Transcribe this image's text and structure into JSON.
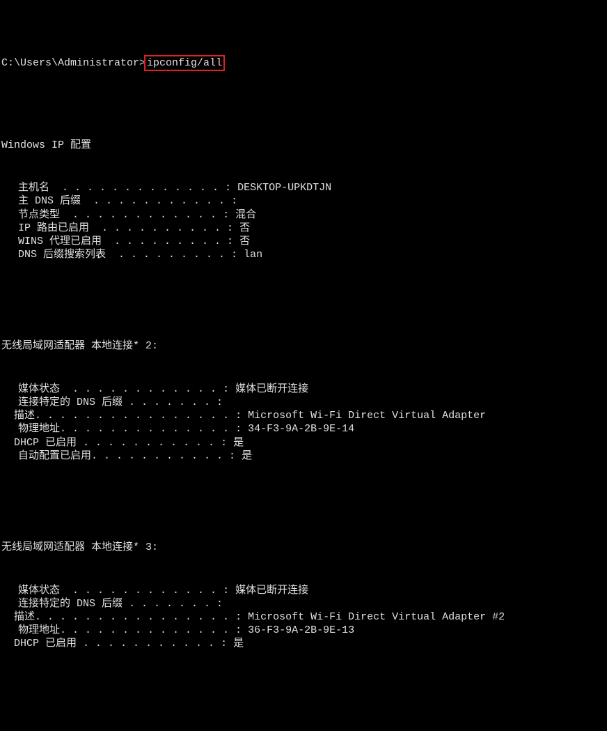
{
  "prompt": {
    "path": "C:\\Users\\Administrator>",
    "command": "ipconfig/all"
  },
  "header": "Windows IP 配置",
  "windows_ip": [
    {
      "label": "主机名 ",
      "dots": " . . . . . . . . . . . . . ",
      "value": "DESKTOP-UPKDTJN"
    },
    {
      "label": "主 DNS 后缀 ",
      "dots": " . . . . . . . . . . . ",
      "value": ""
    },
    {
      "label": "节点类型 ",
      "dots": " . . . . . . . . . . . . ",
      "value": "混合"
    },
    {
      "label": "IP 路由已启用 ",
      "dots": " . . . . . . . . . . ",
      "value": "否"
    },
    {
      "label": "WINS 代理已启用 ",
      "dots": " . . . . . . . . . ",
      "value": "否"
    },
    {
      "label": "DNS 后缀搜索列表 ",
      "dots": " . . . . . . . . . ",
      "value": "lan"
    }
  ],
  "adapter2": {
    "title": "无线局域网适配器 本地连接* 2:",
    "rows": [
      {
        "indent": "indent",
        "label": "媒体状态 ",
        "dots": " . . . . . . . . . . . . ",
        "value": "媒体已断开连接"
      },
      {
        "indent": "indent",
        "label": "连接特定的 DNS 后缀 ",
        "dots": ". . . . . . . ",
        "value": ""
      },
      {
        "indent": "small-indent",
        "label": "描述.",
        "dots": " . . . . . . . . . . . . . . . ",
        "value": "Microsoft Wi-Fi Direct Virtual Adapter"
      },
      {
        "indent": "indent",
        "label": "物理地址.",
        "dots": " . . . . . . . . . . . . . ",
        "value": "34-F3-9A-2B-9E-14"
      },
      {
        "indent": "small-indent",
        "label": "DHCP 已启用 ",
        "dots": ". . . . . . . . . . . ",
        "value": "是"
      },
      {
        "indent": "indent",
        "label": "自动配置已启用.",
        "dots": " . . . . . . . . . . ",
        "value": "是"
      }
    ]
  },
  "adapter3": {
    "title": "无线局域网适配器 本地连接* 3:",
    "rows": [
      {
        "indent": "indent",
        "label": "媒体状态 ",
        "dots": " . . . . . . . . . . . . ",
        "value": "媒体已断开连接"
      },
      {
        "indent": "indent",
        "label": "连接特定的 DNS 后缀 ",
        "dots": ". . . . . . . ",
        "value": ""
      },
      {
        "indent": "small-indent",
        "label": "描述.",
        "dots": " . . . . . . . . . . . . . . . ",
        "value": "Microsoft Wi-Fi Direct Virtual Adapter #2"
      },
      {
        "indent": "indent",
        "label": "物理地址.",
        "dots": " . . . . . . . . . . . . . ",
        "value": "36-F3-9A-2B-9E-13"
      },
      {
        "indent": "small-indent",
        "label": "DHCP 已启用 ",
        "dots": ". . . . . . . . . . . ",
        "value": "是"
      }
    ]
  }
}
